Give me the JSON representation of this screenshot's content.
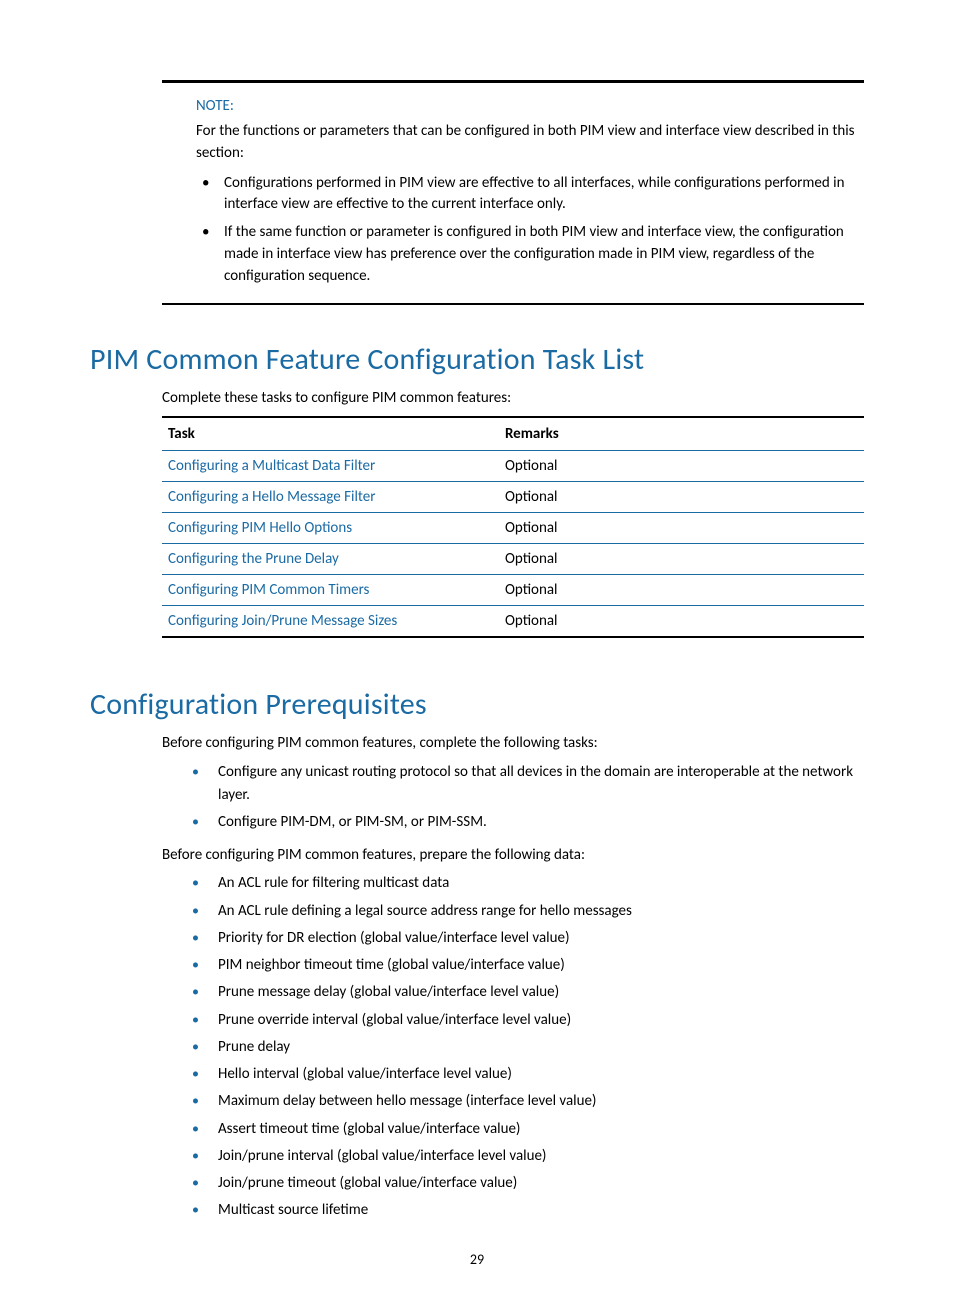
{
  "note": {
    "label": "NOTE:",
    "intro": "For the functions or parameters that can be configured in both PIM view and interface view described in this section:",
    "items": [
      "Configurations performed in PIM view are effective to all interfaces, while configurations performed in interface view are effective to the current interface only.",
      "If the same function or parameter is configured in both PIM view and interface view, the configuration made in interface view has preference over the configuration made in PIM view, regardless of the configuration sequence."
    ]
  },
  "taskList": {
    "heading": "PIM Common Feature Configuration Task List",
    "intro": "Complete these tasks to configure PIM common features:",
    "headers": {
      "task": "Task",
      "remarks": "Remarks"
    },
    "rows": [
      {
        "task": "Configuring a Multicast Data Filter",
        "remarks": "Optional"
      },
      {
        "task": "Configuring a Hello Message Filter",
        "remarks": "Optional"
      },
      {
        "task": "Configuring PIM Hello Options",
        "remarks": "Optional"
      },
      {
        "task": "Configuring the Prune Delay",
        "remarks": "Optional"
      },
      {
        "task": "Configuring PIM Common Timers",
        "remarks": "Optional"
      },
      {
        "task": "Configuring Join/Prune Message Sizes",
        "remarks": "Optional"
      }
    ]
  },
  "prereq": {
    "heading": "Configuration Prerequisites",
    "intro1": "Before configuring PIM common features, complete the following tasks:",
    "list1": [
      "Configure any unicast routing protocol so that all devices in the domain are interoperable at the network layer.",
      "Configure PIM-DM, or PIM-SM, or PIM-SSM."
    ],
    "intro2": "Before configuring PIM common features, prepare the following data:",
    "list2": [
      "An ACL rule for filtering multicast data",
      "An ACL rule defining a legal source address range for hello messages",
      "Priority for DR election (global value/interface level value)",
      "PIM neighbor timeout time (global value/interface value)",
      "Prune message delay (global value/interface level value)",
      "Prune override interval (global value/interface level value)",
      "Prune delay",
      "Hello interval (global value/interface level value)",
      "Maximum delay between hello message (interface level value)",
      "Assert timeout time (global value/interface value)",
      "Join/prune interval (global value/interface level value)",
      "Join/prune timeout (global value/interface value)",
      "Multicast source lifetime"
    ]
  },
  "pageNumber": "29"
}
